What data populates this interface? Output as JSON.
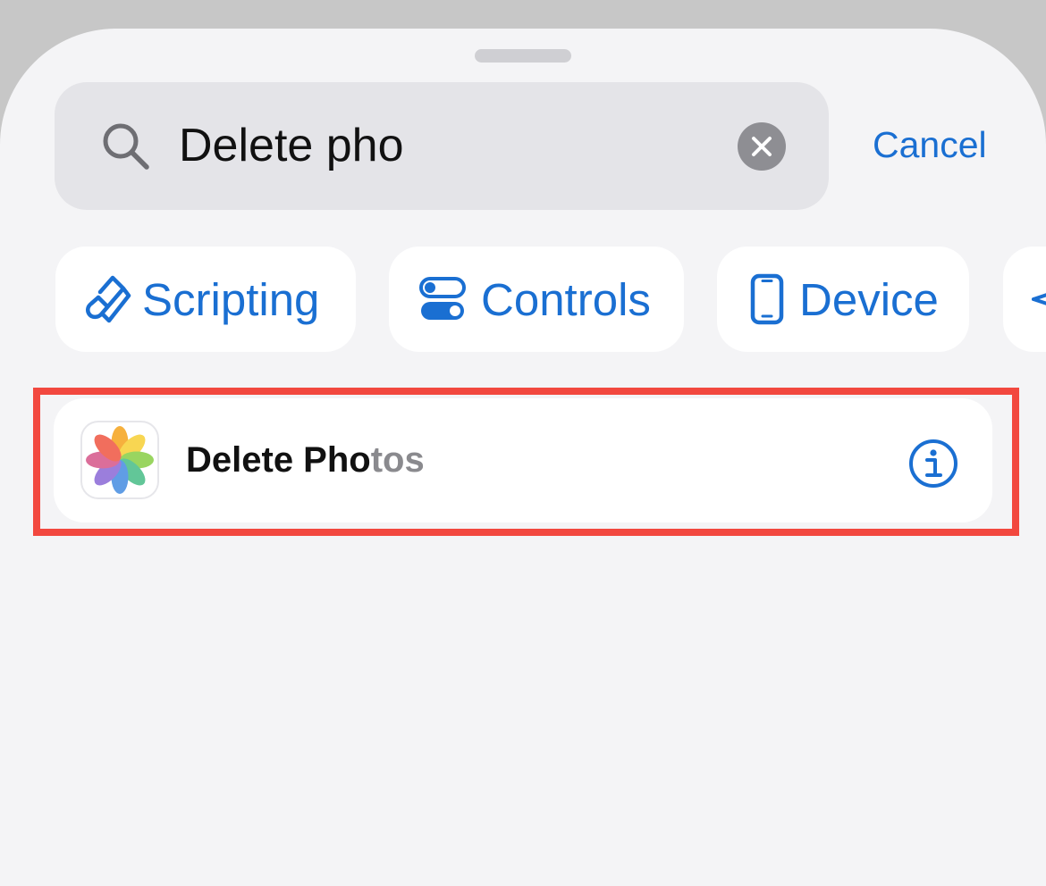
{
  "search": {
    "value": "Delete pho",
    "cancel_label": "Cancel"
  },
  "categories": [
    {
      "label": "Scripting",
      "icon": "scripting-icon"
    },
    {
      "label": "Controls",
      "icon": "toggle-controls-icon"
    },
    {
      "label": "Device",
      "icon": "phone-device-icon"
    }
  ],
  "results": [
    {
      "title_match": "Delete Pho",
      "title_rest": "tos",
      "icon": "photos-app-icon"
    }
  ],
  "colors": {
    "accent": "#1a6fd2",
    "highlight": "#f2483f",
    "background": "#f4f4f6"
  }
}
